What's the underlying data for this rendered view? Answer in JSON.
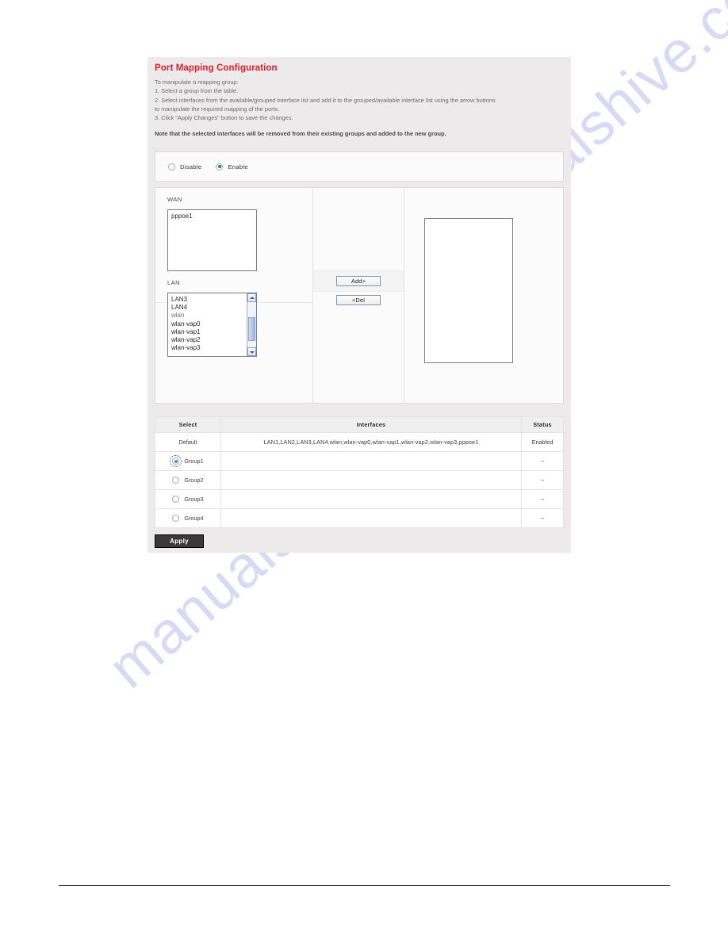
{
  "page": {
    "heading": "Port Mapping Configuration",
    "instructions": [
      "To manipulate a mapping group:",
      "1. Select a group from the table.",
      "2. Select interfaces from the available/grouped interface list and add it to the grouped/available interface list using the arrow buttons",
      "to manipulate the required mapping of the ports.",
      "3. Click \"Apply Changes\" button to save the changes."
    ],
    "note": "Note that the selected interfaces will be removed from their existing groups and added to the new group."
  },
  "mode": {
    "options": [
      {
        "label": "Disable",
        "checked": false
      },
      {
        "label": "Enable",
        "checked": true
      }
    ]
  },
  "transfer": {
    "wan": {
      "label": "WAN",
      "items": [
        "pppoe1"
      ]
    },
    "lan": {
      "label": "LAN",
      "items": [
        "LAN3",
        "LAN4",
        "wlan",
        "wlan-vap0",
        "wlan-vap1",
        "wlan-vap2",
        "wlan-vap3"
      ]
    },
    "buttons": {
      "add": "Add>",
      "del": "<Del"
    },
    "grouped": {
      "items": []
    }
  },
  "table": {
    "headers": [
      "Select",
      "Interfaces",
      "Status"
    ],
    "rows": [
      {
        "select": "Default",
        "has_radio": false,
        "selected": false,
        "interfaces": "LAN1,LAN2,LAN3,LAN4,wlan,wlan-vap0,wlan-vap1,wlan-vap2,wlan-vap3,pppoe1",
        "status": "Enabled"
      },
      {
        "select": "Group1",
        "has_radio": true,
        "selected": true,
        "interfaces": "",
        "status": "--"
      },
      {
        "select": "Group2",
        "has_radio": true,
        "selected": false,
        "interfaces": "",
        "status": "--"
      },
      {
        "select": "Group3",
        "has_radio": true,
        "selected": false,
        "interfaces": "",
        "status": "--"
      },
      {
        "select": "Group4",
        "has_radio": true,
        "selected": false,
        "interfaces": "",
        "status": "--"
      }
    ]
  },
  "actions": {
    "apply": "Apply"
  },
  "watermark": {
    "line1": "manualshive.com",
    "line2": "manualshive.com"
  },
  "colors": {
    "heading": "#e8192c",
    "radio_on": "#1f8a3d",
    "apply_bg": "#3a3a3a",
    "page_bg": "#eceaea"
  }
}
